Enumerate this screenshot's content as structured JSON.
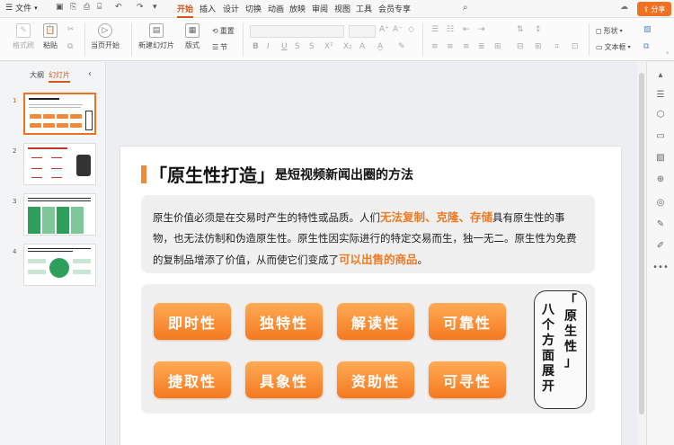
{
  "topbar": {
    "file_menu": "文件",
    "tabs": [
      "开始",
      "插入",
      "设计",
      "切换",
      "动画",
      "放映",
      "审阅",
      "视图",
      "工具",
      "会员专享"
    ],
    "active_tab": "开始",
    "share_label": "分享"
  },
  "ribbon": {
    "format_painter": "格式刷",
    "paste": "粘贴",
    "play_from_current": "当页开始",
    "new_slide": "新建幻灯片",
    "layout": "版式",
    "reset": "重置",
    "section": "节",
    "shape": "形状",
    "textbox": "文本框"
  },
  "left_panel": {
    "tab_outline": "大纲",
    "tab_slides": "幻灯片",
    "slide_numbers": [
      "1",
      "2",
      "3",
      "4"
    ]
  },
  "slide": {
    "title_main": "「原生性打造」",
    "title_sub": "是短视频新闻出圈的方法",
    "desc_part1": "原生价值必须是在交易时产生的特性或品质。人们",
    "desc_hl1": "无法复制、克隆、存储",
    "desc_part2": "具有原生性的事物，也无法仿制和伪造原生性。原生性因实际进行的特定交易而生，独一无二。原生性为免费的复制品增添了价值，从而使它们变成了",
    "desc_hl2": "可以出售的商品",
    "desc_part3": "。",
    "pills": [
      "即时性",
      "独特性",
      "解读性",
      "可靠性",
      "捷取性",
      "具象性",
      "资助性",
      "可寻性"
    ],
    "side_col1": "八个方面展开",
    "side_col2": "「原生性」"
  },
  "colors": {
    "accent": "#ee7222",
    "pill_top": "#ffab55",
    "pill_bottom": "#f57920",
    "highlight": "#ee7a22"
  }
}
